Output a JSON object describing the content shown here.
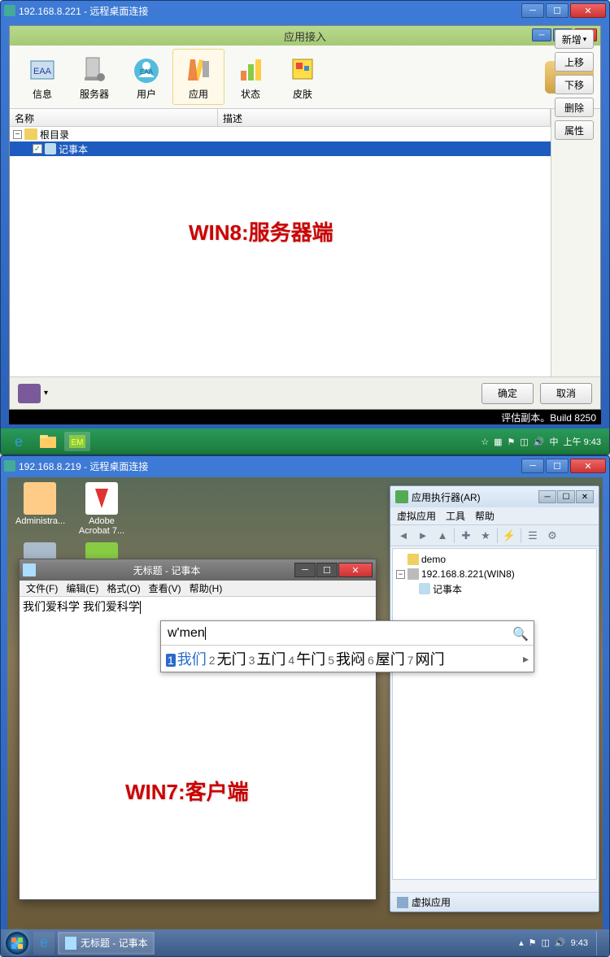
{
  "top": {
    "rdp_title": "192.168.8.221 - 远程桌面连接",
    "app_title": "应用接入",
    "toolbar": {
      "info": "信息",
      "server": "服务器",
      "user": "用户",
      "app": "应用",
      "status": "状态",
      "skin": "皮肤"
    },
    "columns": {
      "name": "名称",
      "desc": "描述"
    },
    "tree": {
      "root": "根目录",
      "item": "记事本"
    },
    "side": {
      "add": "新增",
      "up": "上移",
      "down": "下移",
      "del": "删除",
      "prop": "属性"
    },
    "buttons": {
      "ok": "确定",
      "cancel": "取消"
    },
    "black_strip": "评估副本。Build 8250",
    "taskbar_time": "上午 9:43",
    "annotation": "WIN8:服务器端"
  },
  "bottom": {
    "rdp_title": "192.168.8.219 - 远程桌面连接",
    "desktop_icons": {
      "admin": "Administra...",
      "acrobat": "Adobe Acrobat 7..."
    },
    "ar": {
      "title": "应用执行器(AR)",
      "menu": {
        "virtual": "虚拟应用",
        "tools": "工具",
        "help": "帮助"
      },
      "tree": {
        "demo": "demo",
        "server": "192.168.8.221(WIN8)",
        "notepad": "记事本"
      },
      "footer": "虚拟应用"
    },
    "notepad": {
      "title": "无标题 - 记事本",
      "menu": {
        "file": "文件(F)",
        "edit": "编辑(E)",
        "format": "格式(O)",
        "view": "查看(V)",
        "help": "帮助(H)"
      },
      "text": "我们爱科学 我们爱科学"
    },
    "ime": {
      "input": "w'men",
      "candidates": [
        {
          "n": "1",
          "w": "我们"
        },
        {
          "n": "2",
          "w": "无门"
        },
        {
          "n": "3",
          "w": "五门"
        },
        {
          "n": "4",
          "w": "午门"
        },
        {
          "n": "5",
          "w": "我闷"
        },
        {
          "n": "6",
          "w": "屋门"
        },
        {
          "n": "7",
          "w": "网门"
        }
      ]
    },
    "taskbar": {
      "notepad": "无标题 - 记事本",
      "time": "9:43"
    },
    "annotation": "WIN7:客户端"
  }
}
